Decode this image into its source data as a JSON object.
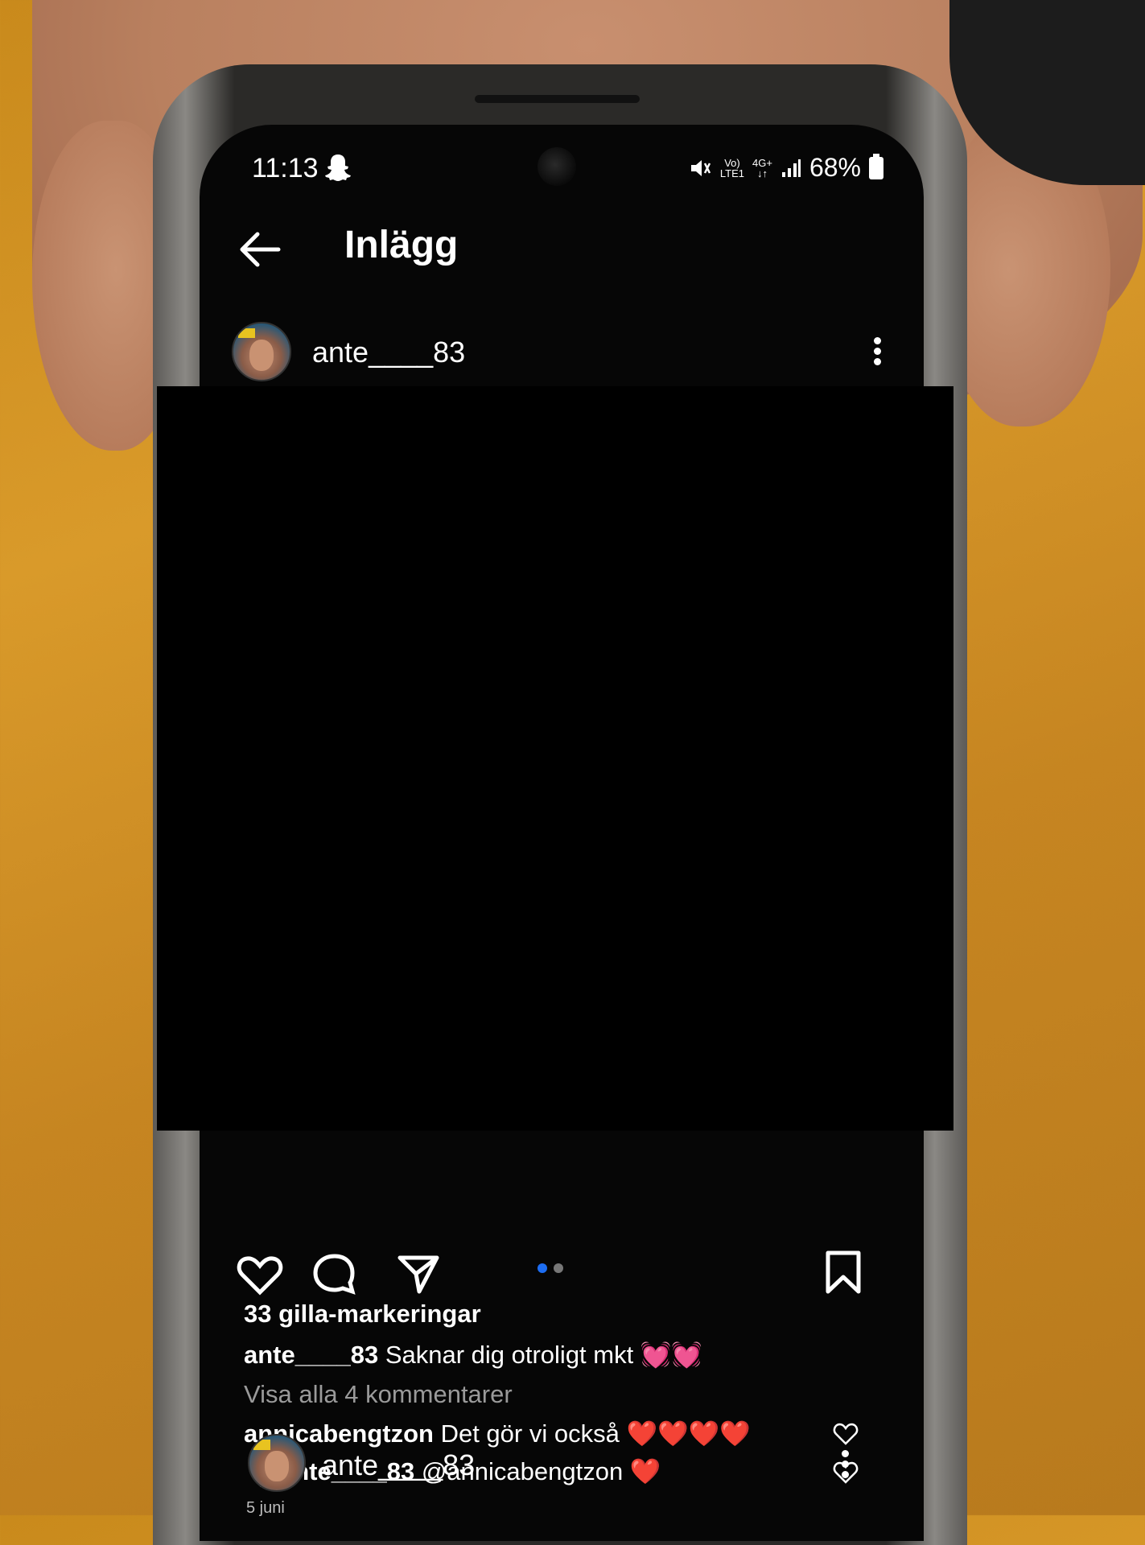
{
  "status_bar": {
    "time": "11:13",
    "net_top": "Vo)",
    "net_bottom": "LTE1",
    "net2_top": "4G+",
    "net2_bottom": "↓↑",
    "battery": "68%"
  },
  "header": {
    "title": "Inlägg"
  },
  "post": {
    "username": "ante____83",
    "likes": "33 gilla-markeringar",
    "caption_user": "ante____83",
    "caption_text": "Saknar dig otroligt mkt 💓💓",
    "view_comments": "Visa alla 4 kommentarer",
    "carousel": {
      "total": 2,
      "active_index": 0
    },
    "comments": [
      {
        "user": "annicabengtzon",
        "text": "Det gör vi också ❤️❤️❤️❤️"
      },
      {
        "user": "ante____83",
        "text": "@annicabengtzon ❤️"
      }
    ],
    "date": "5 juni"
  },
  "next_post": {
    "username": "ante____83"
  },
  "colors": {
    "accent_blue": "#1d6df2",
    "heart_red": "#e0242c"
  }
}
